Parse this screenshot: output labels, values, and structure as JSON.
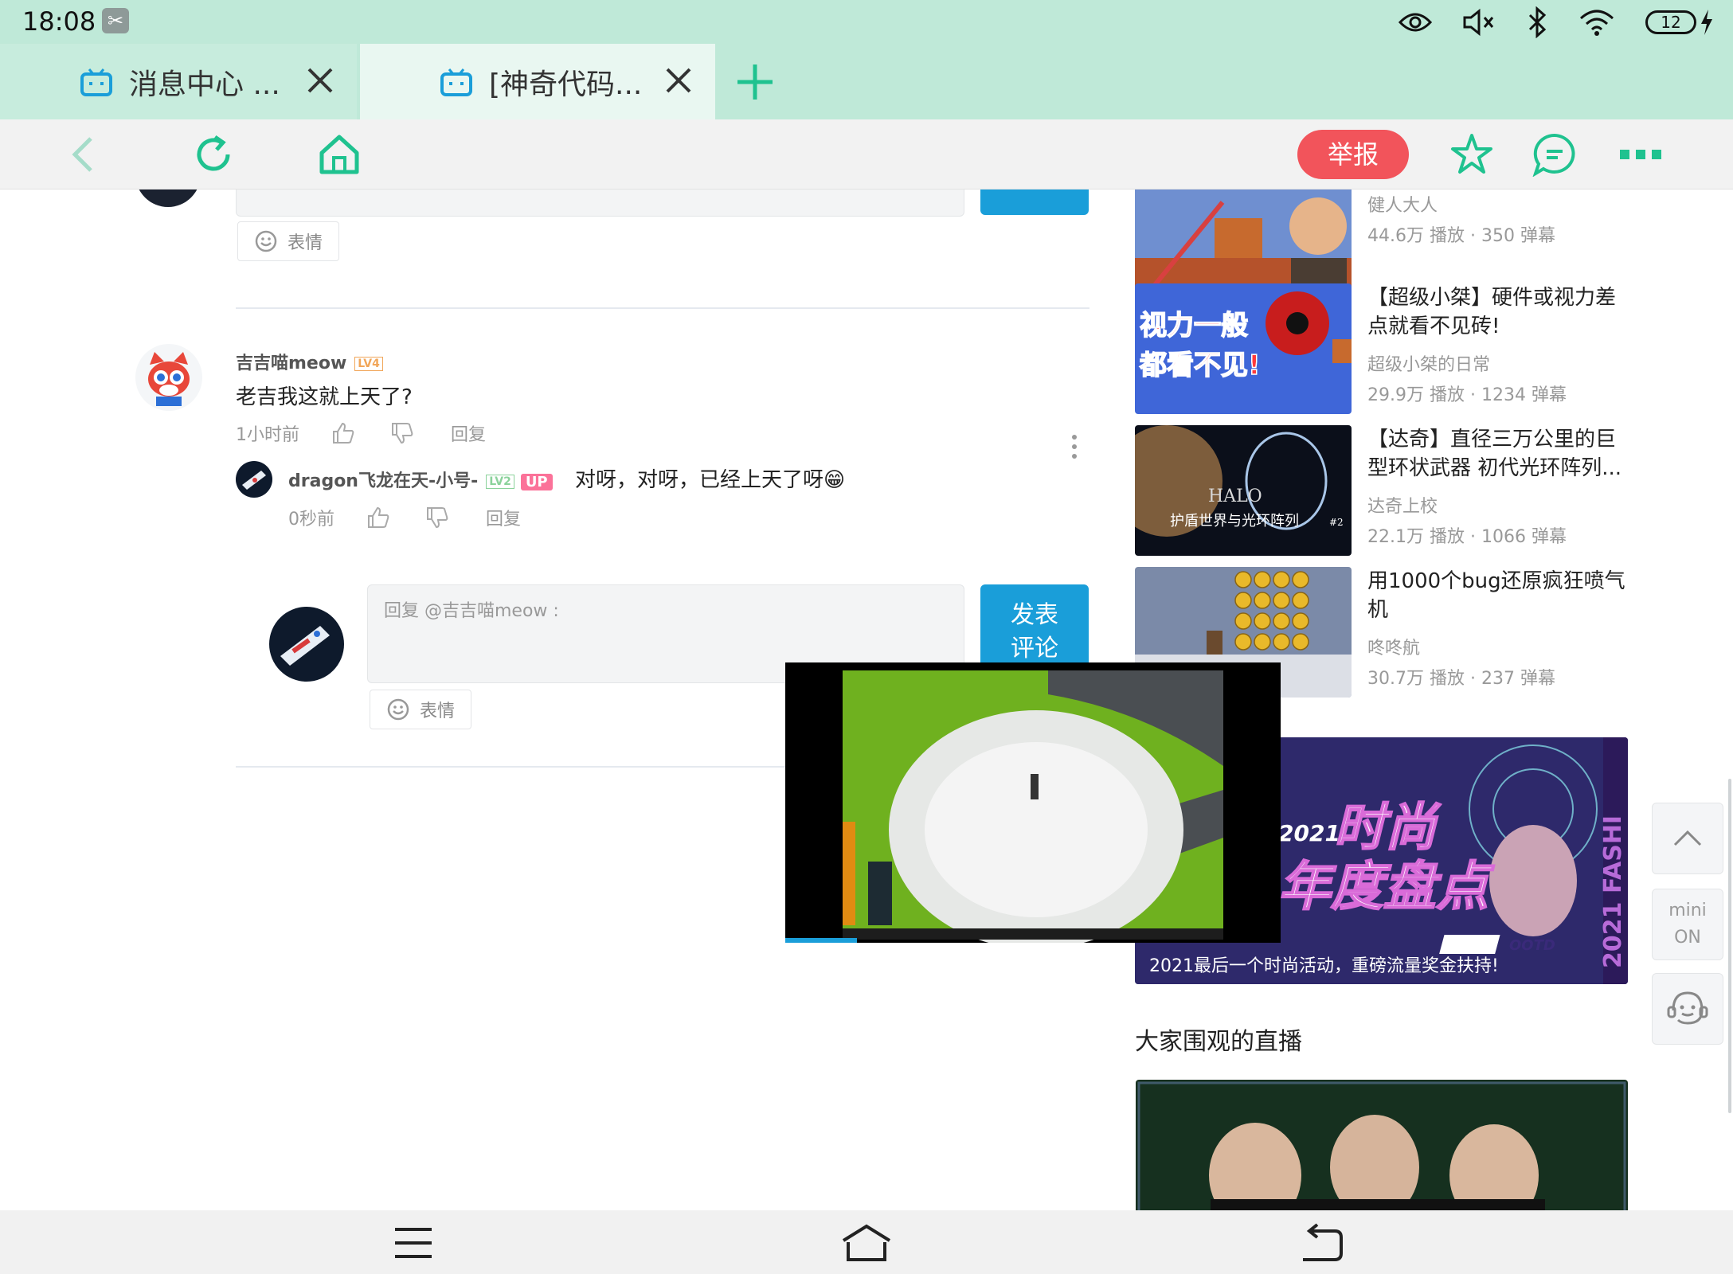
{
  "status_bar": {
    "time": "18:08",
    "battery": "12"
  },
  "tabs": [
    {
      "title": "消息中心 ...",
      "active": false
    },
    {
      "title": "[神奇代码...",
      "active": true
    }
  ],
  "toolbar": {
    "report_label": "举报"
  },
  "comment_top": {
    "emoji_label": "表情"
  },
  "comment": {
    "username": "吉吉喵meow",
    "level": "LV4",
    "text": "老吉我这就上天了?",
    "time": "1小时前",
    "reply_label": "回复"
  },
  "reply": {
    "username": "dragon飞龙在天-小号-",
    "level": "LV2",
    "up_badge": "UP",
    "text": "对呀，对呀，已经上天了呀😁",
    "time": "0秒前",
    "reply_label": "回复"
  },
  "reply_box": {
    "placeholder": "回复 @吉吉喵meow :",
    "submit_line1": "发表",
    "submit_line2": "评论",
    "emoji_label": "表情"
  },
  "recommendations": [
    {
      "title": "",
      "up": "健人大人",
      "stats": "44.6万 播放 · 350 弹幕",
      "thumb_text": ""
    },
    {
      "title": "【超级小桀】硬件或视力差点就看不见砖!",
      "up": "超级小桀的日常",
      "stats": "29.9万 播放 · 1234 弹幕",
      "thumb_text_1": "视力一般",
      "thumb_text_2": "都看不见!"
    },
    {
      "title": "【达奇】直径三万公里的巨型环状武器 初代光环阵列...",
      "up": "达奇上校",
      "stats": "22.1万 播放 · 1066 弹幕",
      "thumb_text": "护盾世界与光环阵列",
      "thumb_sub": "#2",
      "thumb_logo": "HALO"
    },
    {
      "title": "用1000个bug还原疯狂喷气机",
      "up": "咚咚航",
      "stats": "30.7万 播放 · 237 弹幕",
      "thumb_text": ""
    }
  ],
  "banner": {
    "year": "2021",
    "line1": "时尚",
    "line2": "年度盘点",
    "side_text": "2021 FASHI",
    "tag": "OOTD",
    "caption": "2021最后一个时尚活动，重磅流量奖金扶持!"
  },
  "live_section_title": "大家围观的直播",
  "side_buttons": {
    "mini": "mini",
    "on": "ON"
  },
  "colors": {
    "accent": "#1fc28f",
    "report": "#f2545b",
    "submit": "#1a9ed9",
    "tab_bg": "#bfe9d8"
  }
}
